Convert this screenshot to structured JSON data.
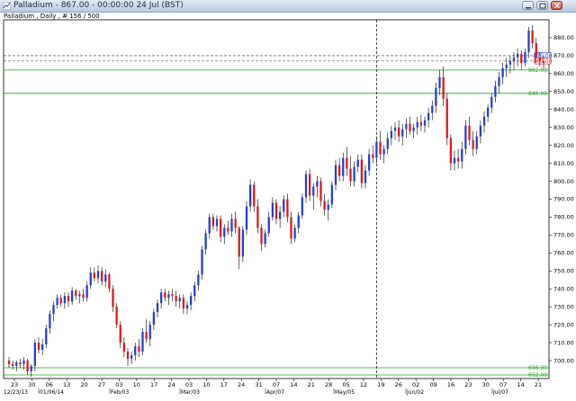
{
  "window": {
    "title": "Palladium - 867.00 - 00:00:00  24 Jul (BST)"
  },
  "chart_data": {
    "type": "candlestick",
    "title": "Palladium , Daily , # 156 / 500",
    "instrument": "Palladium",
    "timeframe": "Daily",
    "last_price": 867.0,
    "ylim": [
      690,
      890
    ],
    "y_ticks": [
      "700.00",
      "710.00",
      "720.00",
      "730.00",
      "740.00",
      "750.00",
      "760.00",
      "770.00",
      "780.00",
      "790.00",
      "800.00",
      "810.00",
      "820.00",
      "830.00",
      "840.00",
      "850.00",
      "860.00",
      "870.00",
      "880.00"
    ],
    "x_tick_labels": [
      "23",
      "30",
      "06",
      "13",
      "20",
      "27",
      "03",
      "10",
      "17",
      "24",
      "03",
      "10",
      "17",
      "24",
      "31",
      "07",
      "14",
      "21",
      "28",
      "05",
      "12",
      "19",
      "26",
      "02",
      "09",
      "16",
      "23",
      "30",
      "07",
      "14",
      "21"
    ],
    "x_date_labels": [
      "12/23/13",
      "01/06/14",
      "Feb/03",
      "Mar/03",
      "Apr/07",
      "May/05",
      "Jun/02",
      "Jul/07"
    ],
    "horizontal_lines": [
      {
        "value": 862.0,
        "label": "862.00",
        "color": "#22a422"
      },
      {
        "value": 849.0,
        "label": "849.00",
        "color": "#22a422"
      },
      {
        "value": 696.0,
        "label": "696.00",
        "color": "#22a422"
      },
      {
        "value": 692.0,
        "label": "692.00",
        "color": "#22a422"
      }
    ],
    "price_markers": [
      {
        "value": 870.0,
        "label": "870.00",
        "color": "#2233cc"
      },
      {
        "value": 867.0,
        "label": "867.00",
        "color": "#cc2233"
      }
    ],
    "crosshair_date_index": 99,
    "bull_color": "#1f3fd6",
    "bear_color": "#e01616",
    "candles": [
      [
        700,
        702,
        696,
        698
      ],
      [
        698,
        700,
        695,
        697
      ],
      [
        697,
        700,
        694,
        699
      ],
      [
        699,
        701,
        696,
        698
      ],
      [
        698,
        702,
        695,
        700
      ],
      [
        700,
        701,
        692,
        694
      ],
      [
        694,
        698,
        691,
        697
      ],
      [
        697,
        712,
        694,
        710
      ],
      [
        710,
        713,
        704,
        706
      ],
      [
        706,
        712,
        703,
        709
      ],
      [
        709,
        720,
        707,
        718
      ],
      [
        718,
        728,
        715,
        726
      ],
      [
        726,
        733,
        722,
        731
      ],
      [
        731,
        737,
        729,
        735
      ],
      [
        735,
        737,
        730,
        732
      ],
      [
        732,
        738,
        729,
        736
      ],
      [
        736,
        738,
        730,
        733
      ],
      [
        733,
        741,
        731,
        739
      ],
      [
        739,
        740,
        734,
        736
      ],
      [
        736,
        739,
        732,
        737
      ],
      [
        737,
        740,
        733,
        735
      ],
      [
        735,
        744,
        733,
        742
      ],
      [
        742,
        752,
        740,
        749
      ],
      [
        749,
        752,
        744,
        746
      ],
      [
        746,
        753,
        743,
        750
      ],
      [
        750,
        752,
        742,
        744
      ],
      [
        744,
        751,
        741,
        748
      ],
      [
        748,
        749,
        738,
        740
      ],
      [
        740,
        742,
        727,
        730
      ],
      [
        730,
        732,
        718,
        720
      ],
      [
        720,
        722,
        707,
        710
      ],
      [
        710,
        713,
        702,
        705
      ],
      [
        705,
        707,
        697,
        701
      ],
      [
        701,
        705,
        698,
        703
      ],
      [
        703,
        710,
        700,
        708
      ],
      [
        708,
        712,
        702,
        705
      ],
      [
        705,
        718,
        703,
        716
      ],
      [
        716,
        723,
        710,
        712
      ],
      [
        712,
        722,
        708,
        720
      ],
      [
        720,
        729,
        717,
        727
      ],
      [
        727,
        734,
        724,
        732
      ],
      [
        732,
        740,
        729,
        738
      ],
      [
        738,
        740,
        733,
        735
      ],
      [
        735,
        739,
        731,
        737
      ],
      [
        737,
        740,
        733,
        736
      ],
      [
        736,
        739,
        730,
        733
      ],
      [
        733,
        737,
        729,
        735
      ],
      [
        735,
        737,
        726,
        729
      ],
      [
        729,
        733,
        726,
        731
      ],
      [
        731,
        738,
        728,
        736
      ],
      [
        736,
        744,
        733,
        742
      ],
      [
        742,
        750,
        739,
        748
      ],
      [
        748,
        764,
        745,
        762
      ],
      [
        762,
        773,
        759,
        771
      ],
      [
        771,
        782,
        768,
        780
      ],
      [
        780,
        782,
        773,
        775
      ],
      [
        775,
        781,
        772,
        779
      ],
      [
        779,
        781,
        766,
        769
      ],
      [
        769,
        776,
        765,
        774
      ],
      [
        774,
        778,
        770,
        772
      ],
      [
        772,
        782,
        769,
        779
      ],
      [
        779,
        783,
        771,
        774
      ],
      [
        774,
        775,
        751,
        758
      ],
      [
        758,
        775,
        755,
        773
      ],
      [
        773,
        789,
        770,
        786
      ],
      [
        786,
        801,
        783,
        798
      ],
      [
        798,
        800,
        783,
        786
      ],
      [
        786,
        790,
        771,
        774
      ],
      [
        774,
        776,
        761,
        765
      ],
      [
        765,
        773,
        763,
        771
      ],
      [
        771,
        783,
        769,
        780
      ],
      [
        780,
        791,
        778,
        788
      ],
      [
        788,
        790,
        776,
        779
      ],
      [
        779,
        786,
        774,
        783
      ],
      [
        783,
        792,
        780,
        790
      ],
      [
        790,
        793,
        777,
        780
      ],
      [
        780,
        783,
        765,
        768
      ],
      [
        768,
        776,
        766,
        774
      ],
      [
        774,
        783,
        771,
        781
      ],
      [
        781,
        793,
        779,
        791
      ],
      [
        791,
        806,
        788,
        804
      ],
      [
        804,
        807,
        789,
        792
      ],
      [
        792,
        799,
        784,
        797
      ],
      [
        797,
        803,
        791,
        800
      ],
      [
        800,
        802,
        786,
        789
      ],
      [
        789,
        793,
        781,
        784
      ],
      [
        784,
        790,
        778,
        787
      ],
      [
        787,
        800,
        785,
        798
      ],
      [
        798,
        812,
        795,
        809
      ],
      [
        809,
        813,
        800,
        803
      ],
      [
        803,
        816,
        800,
        813
      ],
      [
        813,
        819,
        803,
        807
      ],
      [
        807,
        814,
        797,
        800
      ],
      [
        800,
        811,
        797,
        808
      ],
      [
        808,
        815,
        805,
        812
      ],
      [
        812,
        815,
        796,
        799
      ],
      [
        799,
        809,
        796,
        806
      ],
      [
        806,
        818,
        803,
        815
      ],
      [
        815,
        820,
        810,
        813
      ],
      [
        813,
        825,
        810,
        822
      ],
      [
        822,
        828,
        812,
        815
      ],
      [
        815,
        820,
        810,
        818
      ],
      [
        818,
        827,
        815,
        824
      ],
      [
        824,
        831,
        820,
        828
      ],
      [
        828,
        833,
        823,
        830
      ],
      [
        830,
        834,
        822,
        825
      ],
      [
        825,
        832,
        820,
        829
      ],
      [
        829,
        835,
        824,
        832
      ],
      [
        832,
        836,
        826,
        828
      ],
      [
        828,
        832,
        824,
        830
      ],
      [
        830,
        836,
        826,
        833
      ],
      [
        833,
        837,
        828,
        831
      ],
      [
        831,
        836,
        827,
        834
      ],
      [
        834,
        841,
        830,
        838
      ],
      [
        838,
        845,
        834,
        842
      ],
      [
        842,
        855,
        838,
        852
      ],
      [
        852,
        862,
        848,
        858
      ],
      [
        858,
        864,
        842,
        846
      ],
      [
        846,
        849,
        820,
        824
      ],
      [
        824,
        826,
        806,
        810
      ],
      [
        810,
        817,
        806,
        813
      ],
      [
        813,
        818,
        807,
        811
      ],
      [
        811,
        822,
        807,
        818
      ],
      [
        818,
        834,
        815,
        831
      ],
      [
        831,
        836,
        820,
        823
      ],
      [
        823,
        828,
        814,
        818
      ],
      [
        818,
        828,
        815,
        825
      ],
      [
        825,
        834,
        821,
        831
      ],
      [
        831,
        839,
        827,
        836
      ],
      [
        836,
        843,
        833,
        841
      ],
      [
        841,
        849,
        838,
        847
      ],
      [
        847,
        856,
        844,
        853
      ],
      [
        853,
        861,
        849,
        858
      ],
      [
        858,
        866,
        854,
        863
      ],
      [
        863,
        869,
        858,
        865
      ],
      [
        865,
        870,
        860,
        867
      ],
      [
        867,
        872,
        862,
        869
      ],
      [
        869,
        874,
        864,
        871
      ],
      [
        871,
        873,
        862,
        866
      ],
      [
        866,
        874,
        864,
        872
      ],
      [
        872,
        886,
        869,
        884
      ],
      [
        884,
        887,
        874,
        877
      ],
      [
        877,
        880,
        866,
        869
      ],
      [
        869,
        872,
        864,
        867
      ],
      [
        867,
        870,
        863,
        866
      ]
    ]
  }
}
